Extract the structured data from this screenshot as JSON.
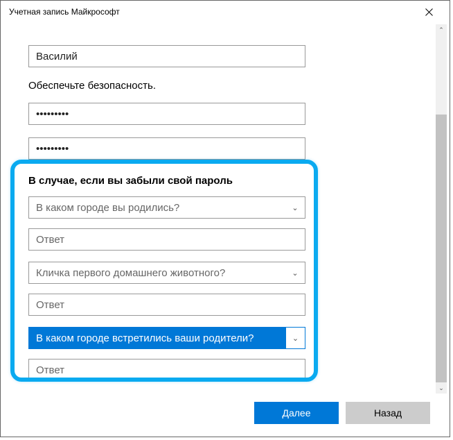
{
  "window": {
    "title": "Учетная запись Майкрософт"
  },
  "fields": {
    "name_value": "Василий",
    "security_heading": "Обеспечьте безопасность.",
    "password1_masked": "•••••••••",
    "password2_masked": "•••••••••"
  },
  "recovery": {
    "heading": "В случае, если вы забыли свой пароль",
    "question1": "В каком городе вы родились?",
    "answer1_placeholder": "Ответ",
    "question2": "Кличка первого домашнего животного?",
    "answer2_placeholder": "Ответ",
    "question3": "В каком городе встретились ваши родители?",
    "answer3_placeholder": "Ответ"
  },
  "buttons": {
    "next": "Далее",
    "back": "Назад"
  }
}
